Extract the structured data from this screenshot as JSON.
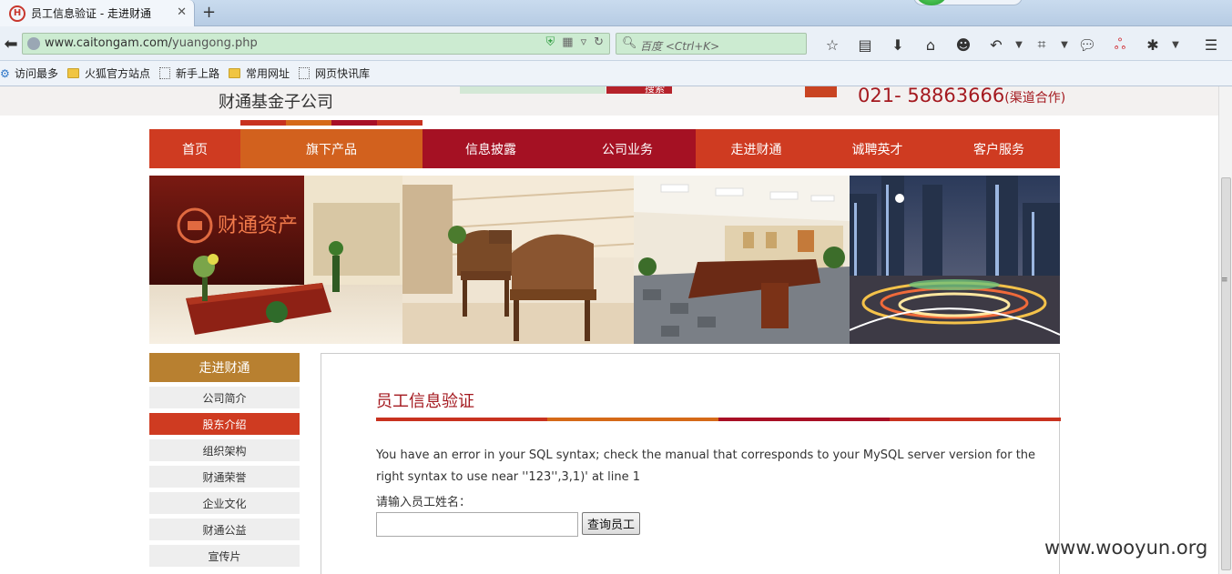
{
  "browser": {
    "tab_title": "员工信息验证 - 走进财通",
    "favicon_letter": "H",
    "url_domain": "www.caitongam.com/",
    "url_path": "yuangong.php",
    "search_placeholder": "百度 <Ctrl+K>",
    "icons": [
      "star-icon",
      "reading-list-icon",
      "download-icon",
      "home-icon",
      "chat-icon",
      "undo-icon",
      "crop-icon",
      "speech-icon",
      "weibo-icon",
      "extension-icon",
      "menu-icon"
    ]
  },
  "bookmarks": [
    {
      "label": "访问最多",
      "kind": "gear"
    },
    {
      "label": "火狐官方站点",
      "kind": "folder"
    },
    {
      "label": "新手上路",
      "kind": "page"
    },
    {
      "label": "常用网址",
      "kind": "folder"
    },
    {
      "label": "网页快讯库",
      "kind": "page"
    }
  ],
  "site": {
    "company_name": "财通基金子公司",
    "search_button": "搜索",
    "phone": "021- 58863666",
    "phone_note": "(渠道合作)",
    "accent_colors": [
      "#c8321f",
      "#d56a18",
      "#a80f25",
      "#c8321f"
    ]
  },
  "nav": [
    {
      "label": "首页",
      "color": "#cf3b21"
    },
    {
      "label": "旗下产品",
      "color": "#d2611e"
    },
    {
      "label": "信息披露",
      "color": "#a51123"
    },
    {
      "label": "公司业务",
      "color": "#a51123"
    },
    {
      "label": "走进财通",
      "color": "#cf3b21"
    },
    {
      "label": "诚聘英才",
      "color": "#cf3b21"
    },
    {
      "label": "客户服务",
      "color": "#cf3b21"
    }
  ],
  "banner_logo_text": "财通资产",
  "sidebar": {
    "title": "走进财通",
    "items": [
      {
        "label": "公司简介",
        "active": false
      },
      {
        "label": "股东介绍",
        "active": true
      },
      {
        "label": "组织架构",
        "active": false
      },
      {
        "label": "财通荣誉",
        "active": false
      },
      {
        "label": "企业文化",
        "active": false
      },
      {
        "label": "财通公益",
        "active": false
      },
      {
        "label": "宣传片",
        "active": false
      }
    ]
  },
  "content": {
    "title": "员工信息验证",
    "sql_error": "You have an error in your SQL syntax; check the manual that corresponds to your MySQL server version for the right syntax to use near ''123'',3,1)' at line 1",
    "prompt_label": "请输入员工姓名：",
    "input_value": "",
    "query_button": "查询员工"
  },
  "watermark": "www.wooyun.org"
}
